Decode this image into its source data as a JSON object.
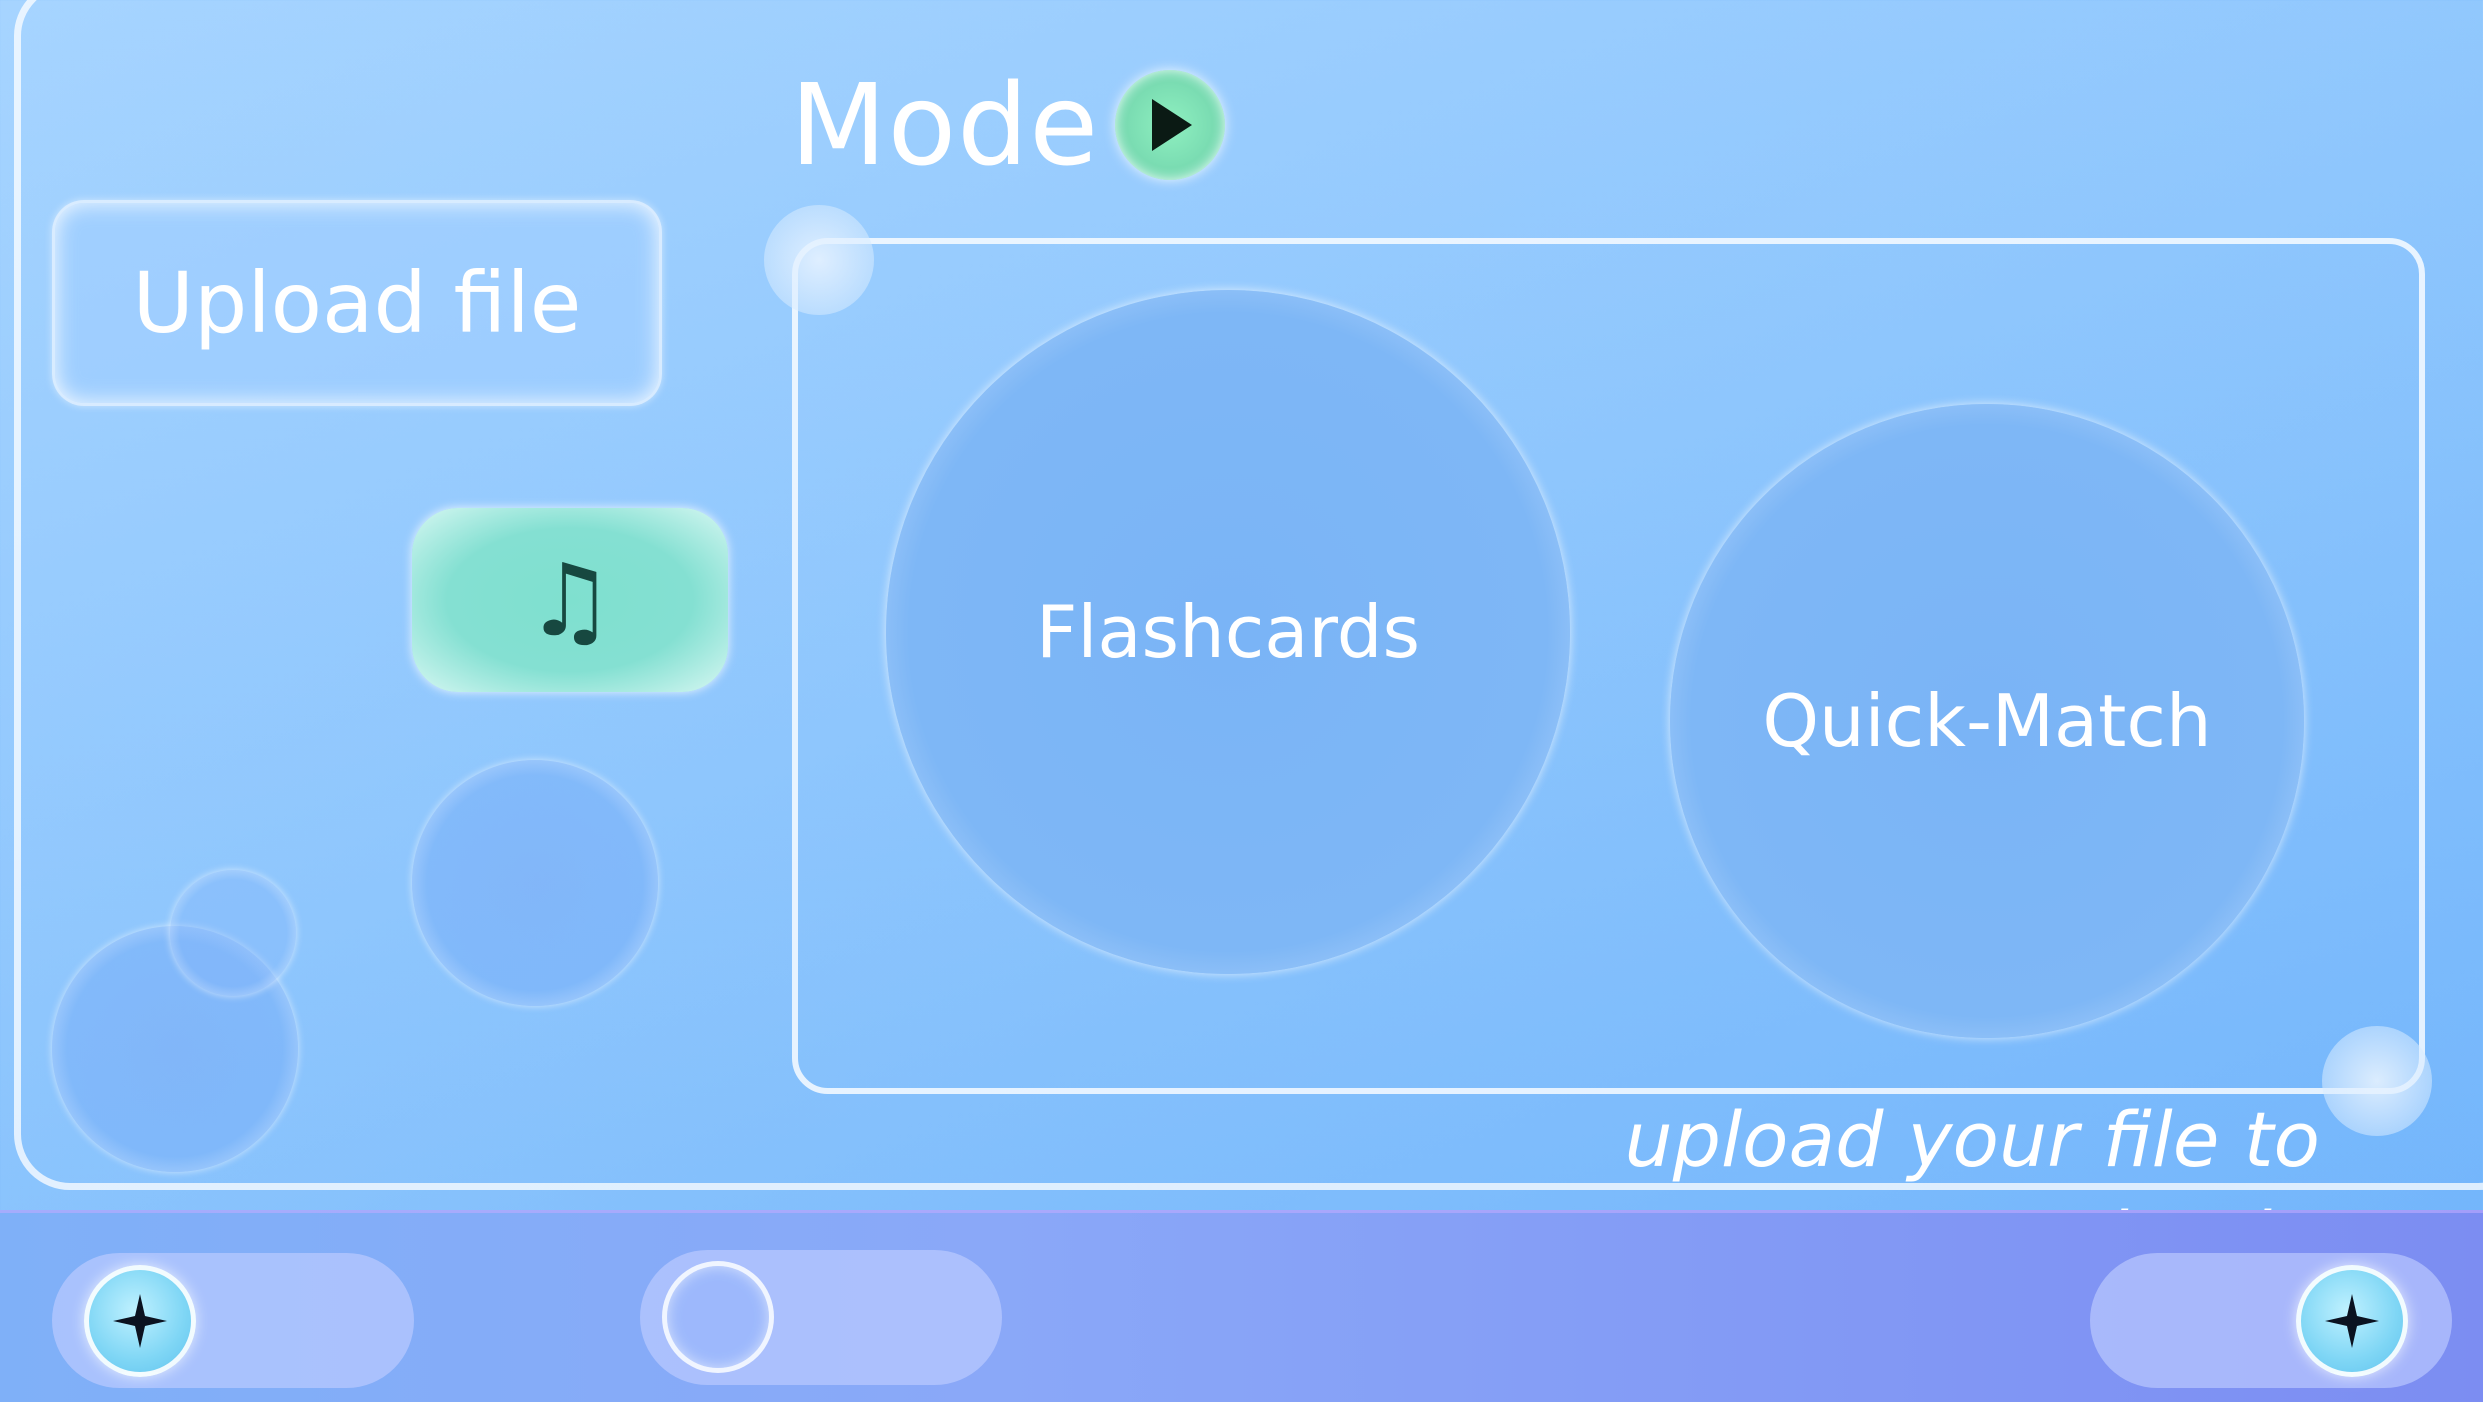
{
  "app": {
    "mode_title": "Mode",
    "upload_label": "Upload file",
    "music_glyph": "♫",
    "hint": "upload your file to begin"
  },
  "modes": [
    {
      "label": "Flashcards"
    },
    {
      "label": "Quick-Match"
    }
  ],
  "icons": {
    "play": "play-icon",
    "music": "music-note-icon",
    "star": "four-point-star-icon"
  },
  "colors": {
    "background": "#8ec6fd",
    "accent_green": "#7adcb2",
    "accent_teal": "#84e0d2",
    "bottom_bar": "#8aa8f8",
    "text": "#ffffff"
  }
}
